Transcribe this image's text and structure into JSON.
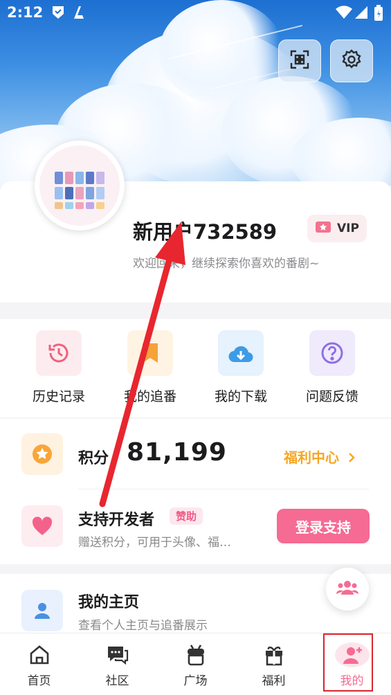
{
  "status_bar": {
    "time": "2:12"
  },
  "profile": {
    "username": "新用户732589",
    "welcome": "欢迎回来，继续探索你喜欢的番剧~",
    "vip_label": "VIP"
  },
  "quick_actions": [
    {
      "label": "历史记录",
      "icon": "history-icon"
    },
    {
      "label": "我的追番",
      "icon": "bookmark-icon"
    },
    {
      "label": "我的下载",
      "icon": "cloud-download-icon"
    },
    {
      "label": "问题反馈",
      "icon": "help-icon"
    }
  ],
  "points": {
    "label": "积分",
    "value": "81,199",
    "link": "福利中心"
  },
  "developer": {
    "title": "支持开发者",
    "badge": "赞助",
    "subtitle": "赠送积分，可用于头像、福…",
    "button": "登录支持"
  },
  "homepage": {
    "title": "我的主页",
    "subtitle": "查看个人主页与追番展示"
  },
  "nav": [
    {
      "label": "首页",
      "icon": "home-icon"
    },
    {
      "label": "社区",
      "icon": "chat-icon"
    },
    {
      "label": "广场",
      "icon": "plaza-icon"
    },
    {
      "label": "福利",
      "icon": "gift-icon"
    },
    {
      "label": "我的",
      "icon": "profile-icon",
      "active": true
    }
  ],
  "colors": {
    "accent": "#f56b93",
    "gold": "#f5a623",
    "annotation": "#d7262f"
  }
}
